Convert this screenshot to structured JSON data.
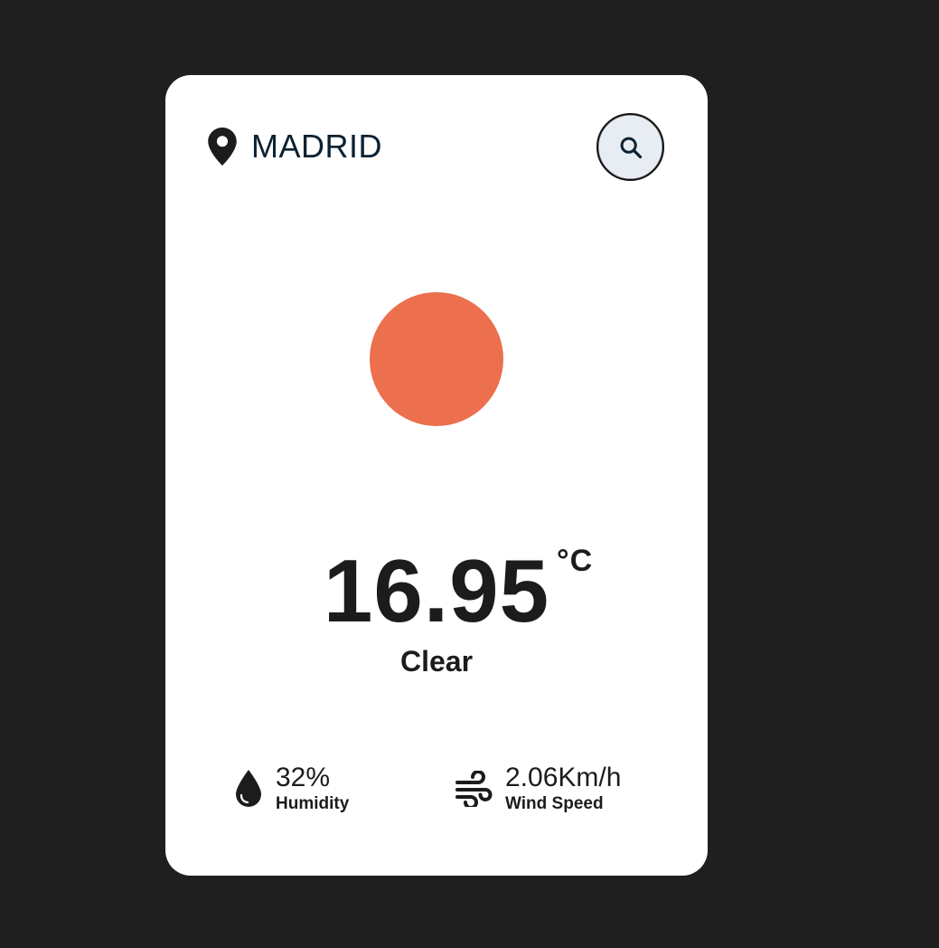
{
  "location": {
    "icon": "map-pin-icon",
    "city": "MADRID"
  },
  "search": {
    "icon": "search-icon"
  },
  "weather": {
    "icon": "sun-icon",
    "icon_color": "#ec6f4e",
    "temperature": "16.95",
    "unit": "°C",
    "condition": "Clear"
  },
  "details": {
    "humidity": {
      "icon": "water-drop-icon",
      "value": "32%",
      "label": "Humidity"
    },
    "wind": {
      "icon": "wind-icon",
      "value": "2.06Km/h",
      "label": "Wind Speed"
    }
  },
  "colors": {
    "background": "#1f1f1f",
    "card": "#ffffff",
    "search_button": "#e8edf3",
    "text": "#1c1c1c"
  }
}
